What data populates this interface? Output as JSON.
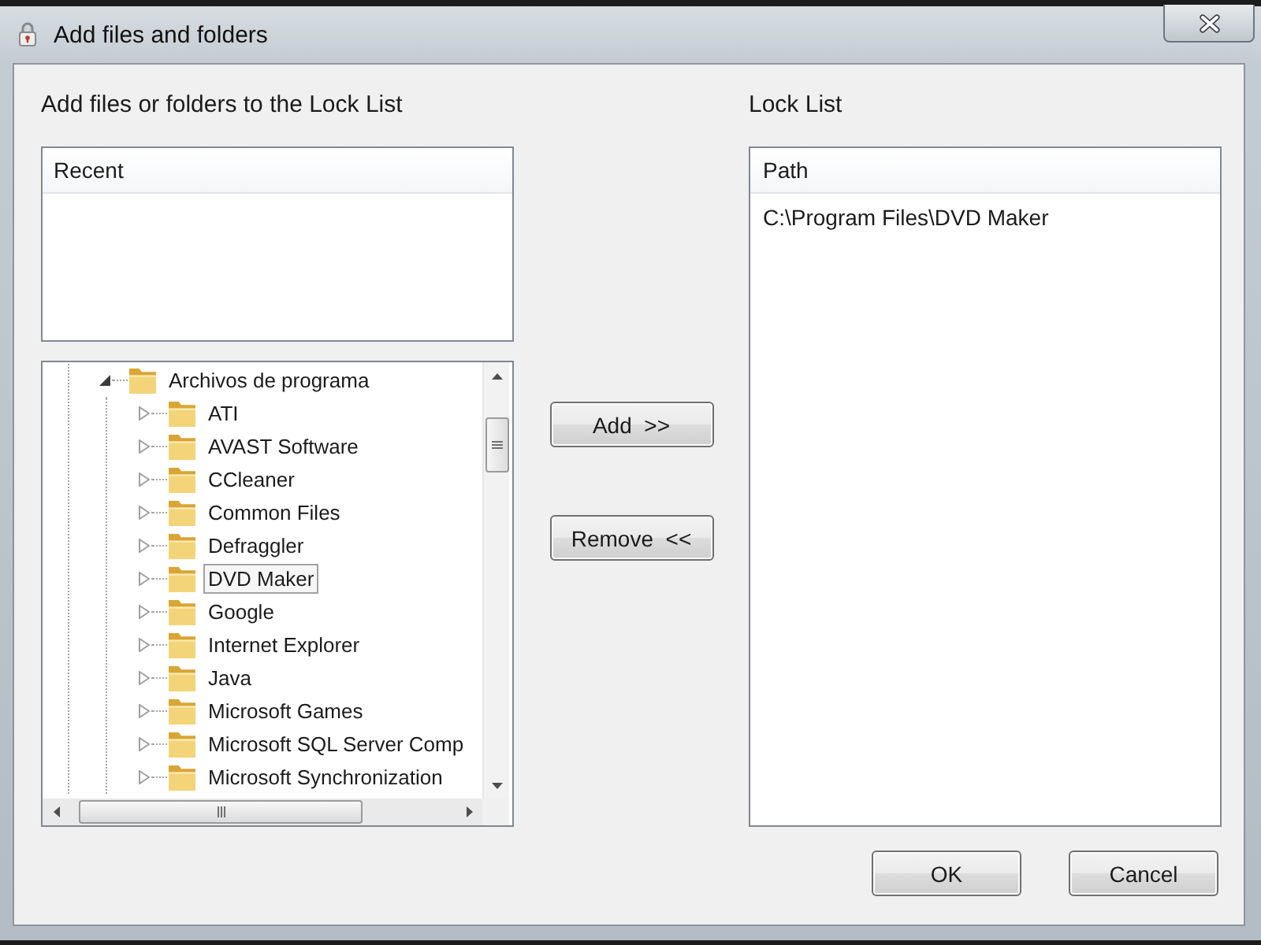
{
  "window": {
    "title": "Add files and folders"
  },
  "add_panel": {
    "heading": "Add files or folders to the Lock List",
    "recent": {
      "columns": [
        "Recent"
      ]
    },
    "tree": [
      {
        "label": "Archivos de programa",
        "expanded": true,
        "selected": false,
        "children": [
          {
            "label": "ATI",
            "expanded": false,
            "selected": false
          },
          {
            "label": "AVAST Software",
            "expanded": false,
            "selected": false
          },
          {
            "label": "CCleaner",
            "expanded": false,
            "selected": false
          },
          {
            "label": "Common Files",
            "expanded": false,
            "selected": false
          },
          {
            "label": "Defraggler",
            "expanded": false,
            "selected": false
          },
          {
            "label": "DVD Maker",
            "expanded": false,
            "selected": true
          },
          {
            "label": "Google",
            "expanded": false,
            "selected": false
          },
          {
            "label": "Internet Explorer",
            "expanded": false,
            "selected": false
          },
          {
            "label": "Java",
            "expanded": false,
            "selected": false
          },
          {
            "label": "Microsoft Games",
            "expanded": false,
            "selected": false
          },
          {
            "label": "Microsoft SQL Server Comp",
            "expanded": false,
            "selected": false
          },
          {
            "label": "Microsoft Synchronization",
            "expanded": false,
            "selected": false
          }
        ]
      }
    ]
  },
  "transfer_buttons": [
    {
      "label": "Add  >>"
    },
    {
      "label": "Remove  <<"
    }
  ],
  "lock_panel": {
    "heading": "Lock List",
    "columns": [
      "Path"
    ],
    "rows": [
      "C:\\Program Files\\DVD Maker"
    ]
  },
  "dialog_buttons": [
    {
      "label": "OK"
    },
    {
      "label": "Cancel"
    }
  ]
}
